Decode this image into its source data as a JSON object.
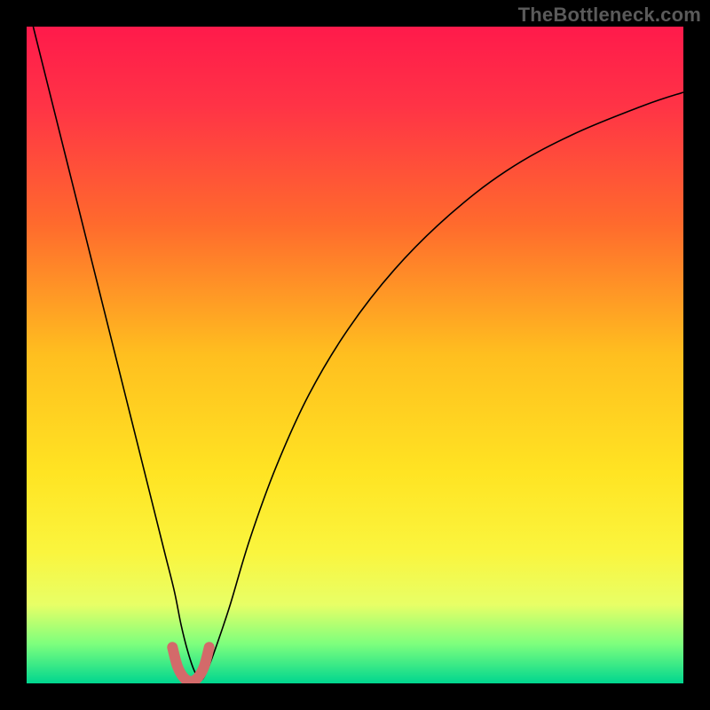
{
  "watermark": "TheBottleneck.com",
  "chart_data": {
    "type": "line",
    "title": "",
    "xlabel": "",
    "ylabel": "",
    "xlim": [
      0,
      100
    ],
    "ylim": [
      0,
      100
    ],
    "grid": false,
    "legend": false,
    "gradient_stops": [
      {
        "offset": 0,
        "color": "#ff1a4b"
      },
      {
        "offset": 0.12,
        "color": "#ff3346"
      },
      {
        "offset": 0.3,
        "color": "#ff6a2d"
      },
      {
        "offset": 0.5,
        "color": "#ffbf1f"
      },
      {
        "offset": 0.68,
        "color": "#ffe423"
      },
      {
        "offset": 0.8,
        "color": "#faf53e"
      },
      {
        "offset": 0.88,
        "color": "#e8ff66"
      },
      {
        "offset": 0.94,
        "color": "#7dff7d"
      },
      {
        "offset": 1.0,
        "color": "#00d68f"
      }
    ],
    "series": [
      {
        "name": "bottleneck-curve",
        "color": "#000000",
        "width": 1.6,
        "x": [
          1,
          3,
          5,
          7,
          9,
          11,
          13,
          15,
          17,
          19,
          21,
          22.5,
          23.5,
          24.5,
          25.5,
          26.5,
          27.5,
          29,
          31,
          34,
          38,
          43,
          49,
          56,
          64,
          73,
          83,
          94,
          100
        ],
        "y": [
          100,
          92,
          84,
          76,
          68,
          60,
          52,
          44,
          36,
          28,
          20,
          14,
          9,
          5,
          2,
          0.5,
          2,
          6,
          12,
          22,
          33,
          44,
          54,
          63,
          71,
          78,
          83.5,
          88,
          90
        ]
      },
      {
        "name": "highlight-valley",
        "color": "#d36a6a",
        "width": 12,
        "linecap": "round",
        "x": [
          22.2,
          23,
          24,
          25,
          26,
          27,
          27.8
        ],
        "y": [
          5.5,
          2.5,
          0.8,
          0.3,
          0.8,
          2.5,
          5.5
        ]
      }
    ]
  }
}
